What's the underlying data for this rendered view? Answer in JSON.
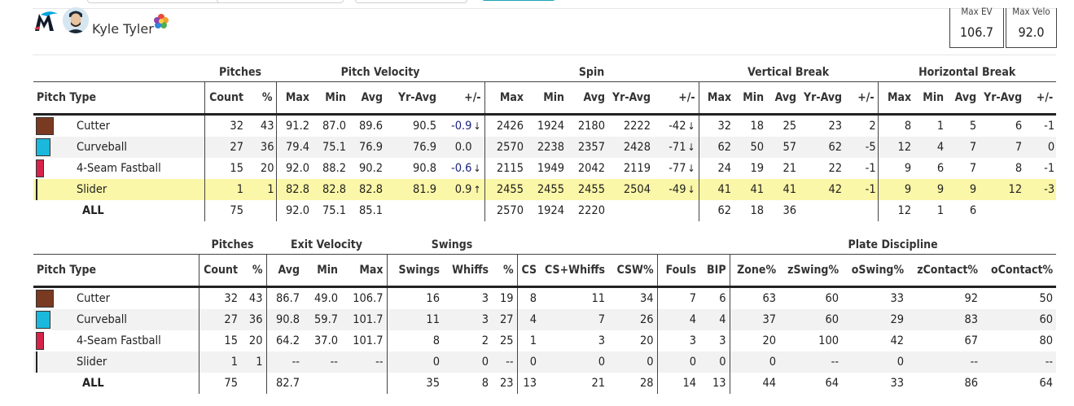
{
  "colors": {
    "cutter": "#7a3a22",
    "curveball": "#1ab8dc",
    "fastball": "#d6234a",
    "slider": "#ffffff",
    "highlight": "#fbf7a8",
    "marlins_black": "#0f1b2b",
    "marlins_blue": "#00a3e0"
  },
  "header": {
    "player_name": "Kyle Tyler",
    "logo_icon": "marlins-logo",
    "avatar_icon": "player-headshot",
    "rating_icon": "rating-badge",
    "max_ev": {
      "label": "Max EV",
      "value": "106.7"
    },
    "max_velo": {
      "label": "Max Velo",
      "value": "92.0"
    }
  },
  "table1": {
    "groups": [
      "Pitches",
      "Pitch Velocity",
      "Spin",
      "Vertical Break",
      "Horizontal Break"
    ],
    "headers": [
      "Pitch Type",
      "Count",
      "%",
      "Max",
      "Min",
      "Avg",
      "Yr-Avg",
      "+/-",
      "Max",
      "Min",
      "Avg",
      "Yr-Avg",
      "+/-",
      "Max",
      "Min",
      "Avg",
      "Yr-Avg",
      "+/-",
      "Max",
      "Min",
      "Avg",
      "Yr-Avg",
      "+/-"
    ],
    "rows": [
      {
        "name": "Cutter",
        "count": "32",
        "pct": "43",
        "vmax": "91.2",
        "vmin": "87.0",
        "vavg": "89.6",
        "vyr": "90.5",
        "vdiff": "-0.9",
        "vdir": "↓",
        "smax": "2426",
        "smin": "1924",
        "savg": "2180",
        "syr": "2222",
        "sdiff": "-42",
        "sdir": "↓",
        "vbmax": "32",
        "vbmin": "18",
        "vbavg": "25",
        "vbyr": "23",
        "vbdiff": "2",
        "hbmax": "8",
        "hbmin": "1",
        "hbavg": "5",
        "hbyr": "6",
        "hbdiff": "-1"
      },
      {
        "name": "Curveball",
        "count": "27",
        "pct": "36",
        "vmax": "79.4",
        "vmin": "75.1",
        "vavg": "76.9",
        "vyr": "76.9",
        "vdiff": "0.0",
        "vdir": "",
        "smax": "2570",
        "smin": "2238",
        "savg": "2357",
        "syr": "2428",
        "sdiff": "-71",
        "sdir": "↓",
        "vbmax": "62",
        "vbmin": "50",
        "vbavg": "57",
        "vbyr": "62",
        "vbdiff": "-5",
        "hbmax": "12",
        "hbmin": "4",
        "hbavg": "7",
        "hbyr": "7",
        "hbdiff": "0"
      },
      {
        "name": "4-Seam Fastball",
        "count": "15",
        "pct": "20",
        "vmax": "92.0",
        "vmin": "88.2",
        "vavg": "90.2",
        "vyr": "90.8",
        "vdiff": "-0.6",
        "vdir": "↓",
        "smax": "2115",
        "smin": "1949",
        "savg": "2042",
        "syr": "2119",
        "sdiff": "-77",
        "sdir": "↓",
        "vbmax": "24",
        "vbmin": "19",
        "vbavg": "21",
        "vbyr": "22",
        "vbdiff": "-1",
        "hbmax": "9",
        "hbmin": "6",
        "hbavg": "7",
        "hbyr": "8",
        "hbdiff": "-1"
      },
      {
        "name": "Slider",
        "count": "1",
        "pct": "1",
        "vmax": "82.8",
        "vmin": "82.8",
        "vavg": "82.8",
        "vyr": "81.9",
        "vdiff": "0.9",
        "vdir": "↑",
        "smax": "2455",
        "smin": "2455",
        "savg": "2455",
        "syr": "2504",
        "sdiff": "-49",
        "sdir": "↓",
        "vbmax": "41",
        "vbmin": "41",
        "vbavg": "41",
        "vbyr": "42",
        "vbdiff": "-1",
        "hbmax": "9",
        "hbmin": "9",
        "hbavg": "9",
        "hbyr": "12",
        "hbdiff": "-3"
      }
    ],
    "all": {
      "name": "ALL",
      "count": "75",
      "vmax": "92.0",
      "vmin": "75.1",
      "vavg": "85.1",
      "smax": "2570",
      "smin": "1924",
      "savg": "2220",
      "vbmax": "62",
      "vbmin": "18",
      "vbavg": "36",
      "hbmax": "12",
      "hbmin": "1",
      "hbavg": "6"
    }
  },
  "table2": {
    "groups": [
      "Pitches",
      "Exit Velocity",
      "Swings",
      "Plate Discipline"
    ],
    "headers": [
      "Pitch Type",
      "Count",
      "%",
      "Avg",
      "Min",
      "Max",
      "Swings",
      "Whiffs",
      "%",
      "CS",
      "CS+Whiffs",
      "CSW%",
      "Fouls",
      "BIP",
      "Zone%",
      "zSwing%",
      "oSwing%",
      "zContact%",
      "oContact%"
    ],
    "rows": [
      {
        "name": "Cutter",
        "count": "32",
        "pct": "43",
        "evavg": "86.7",
        "evmin": "49.0",
        "evmax": "106.7",
        "sw": "16",
        "wh": "3",
        "whp": "19",
        "cs": "8",
        "csw": "11",
        "cswp": "34",
        "fouls": "7",
        "bip": "6",
        "zone": "63",
        "zsw": "60",
        "osw": "33",
        "zc": "92",
        "oc": "50"
      },
      {
        "name": "Curveball",
        "count": "27",
        "pct": "36",
        "evavg": "90.8",
        "evmin": "59.7",
        "evmax": "101.7",
        "sw": "11",
        "wh": "3",
        "whp": "27",
        "cs": "4",
        "csw": "7",
        "cswp": "26",
        "fouls": "4",
        "bip": "4",
        "zone": "37",
        "zsw": "60",
        "osw": "29",
        "zc": "83",
        "oc": "60"
      },
      {
        "name": "4-Seam Fastball",
        "count": "15",
        "pct": "20",
        "evavg": "64.2",
        "evmin": "37.0",
        "evmax": "101.7",
        "sw": "8",
        "wh": "2",
        "whp": "25",
        "cs": "1",
        "csw": "3",
        "cswp": "20",
        "fouls": "3",
        "bip": "3",
        "zone": "20",
        "zsw": "100",
        "osw": "42",
        "zc": "67",
        "oc": "80"
      },
      {
        "name": "Slider",
        "count": "1",
        "pct": "1",
        "evavg": "--",
        "evmin": "--",
        "evmax": "--",
        "sw": "0",
        "wh": "0",
        "whp": "--",
        "cs": "0",
        "csw": "0",
        "cswp": "0",
        "fouls": "0",
        "bip": "0",
        "zone": "0",
        "zsw": "--",
        "osw": "0",
        "zc": "--",
        "oc": "--"
      }
    ],
    "all": {
      "name": "ALL",
      "count": "75",
      "evavg": "82.7",
      "sw": "35",
      "wh": "8",
      "whp": "23",
      "cs": "13",
      "csw": "21",
      "cswp": "28",
      "fouls": "14",
      "bip": "13",
      "zone": "44",
      "zsw": "64",
      "osw": "33",
      "zc": "86",
      "oc": "64"
    }
  }
}
